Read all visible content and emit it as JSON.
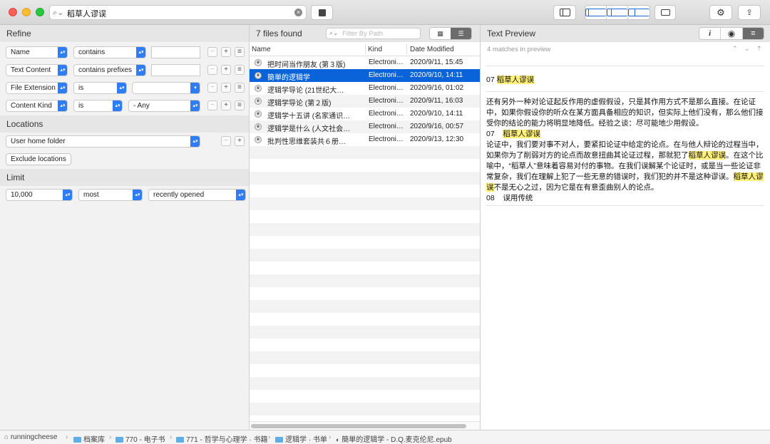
{
  "toolbar": {
    "search_query": "稻草人谬误",
    "icons": {
      "search": "magnifier-icon",
      "clear": "clear-icon",
      "stop": "stop-icon",
      "sidebar": "sidebar-icon",
      "layout_left": "layout-left-icon",
      "layout_middle": "layout-middle-icon",
      "layout_right": "layout-right-icon",
      "window": "window-icon",
      "settings": "gear-icon",
      "share": "share-icon"
    }
  },
  "refine": {
    "title": "Refine",
    "rules": [
      {
        "attribute": "Name",
        "operator": "contains",
        "value": ""
      },
      {
        "attribute": "Text Content",
        "operator": "contains prefixes",
        "value": ""
      },
      {
        "attribute": "File Extension",
        "operator": "is",
        "value": ""
      },
      {
        "attribute": "Content Kind",
        "operator": "is",
        "value": "- Any"
      }
    ],
    "rule_buttons": {
      "remove": "−",
      "add": "+",
      "more": "≡"
    }
  },
  "locations": {
    "title": "Locations",
    "selected": "User home folder",
    "exclude_label": "Exclude locations"
  },
  "limit": {
    "title": "Limit",
    "count": "10,000",
    "mode": "most",
    "criterion": "recently opened"
  },
  "files": {
    "count_label": "7 files found",
    "filter_placeholder": "Filter By Path",
    "columns": [
      "Name",
      "Kind",
      "Date Modified"
    ],
    "rows": [
      {
        "name": "把时间当作朋友 (第３版)",
        "kind": "Electroni…",
        "date": "2020/9/11, 15:45",
        "selected": false
      },
      {
        "name": "簡単的逻辑学",
        "kind": "Electroni…",
        "date": "2020/9/10, 14:11",
        "selected": true
      },
      {
        "name": "逻辑学导论 (21世纪大…",
        "kind": "Electroni…",
        "date": "2020/9/16, 01:02",
        "selected": false
      },
      {
        "name": "逻辑学导论 (第２版)",
        "kind": "Electroni…",
        "date": "2020/9/11, 16:03",
        "selected": false
      },
      {
        "name": "逻辑学十五讲 (名家通识…",
        "kind": "Electroni…",
        "date": "2020/9/10, 14:11",
        "selected": false
      },
      {
        "name": "逻辑学是什么 (人文社会…",
        "kind": "Electroni…",
        "date": "2020/9/16, 00:57",
        "selected": false
      },
      {
        "name": "批判性思维套装共６册…",
        "kind": "Electroni…",
        "date": "2020/9/13, 12:30",
        "selected": false
      }
    ]
  },
  "preview": {
    "title": "Text Preview",
    "matches_label": "4 matches in preview",
    "heading_num": "07",
    "heading_term": "稻草人谬误",
    "para1": "还有另外一种对论证起反作用的虚假假设，只是其作用方式不是那么直接。在论证中，如果你假设你的听众在某方面具备相应的知识，但实际上他们没有，那么他们接受你的结论的能力将明显地降低。经验之谈：尽可能地少用假设。",
    "sub_num": "07",
    "sub_term": "稻草人谬误",
    "para2_a": "论证中，我们要对事不对人，要紧扣论证中给定的论点。在与他人辩论的过程当中，如果你为了削弱对方的论点而故意扭曲其论证过程，那就犯了",
    "para2_term1": "稻草人谬误",
    "para2_b": "。在这个比喻中，“稻草人”意味着容易对付的事物。在我们误解某个论证时，或是当一些论证非常复杂，我们在理解上犯了一些无意的错误时，我们犯的并不是这种谬误。",
    "para2_term2": "稻草人谬误",
    "para2_c": "不是无心之过，因为它是在有意歪曲别人的论点。",
    "next_num": "08",
    "next_title": "误用传统",
    "buttons": {
      "info": "i",
      "eye": "👁",
      "text": "≡"
    }
  },
  "pathbar": {
    "crumbs": [
      "runningcheese",
      "档案库",
      "770 - 电子书",
      "771 - 哲学与心理学 · 书籍",
      "逻辑学 · 书单",
      "簡単的逻辑学 - D.Q.麦克伦尼.epub"
    ]
  },
  "colors": {
    "accent": "#0a63d8",
    "highlight": "#fff07a",
    "popup_arrow": "#2e7cf6"
  }
}
